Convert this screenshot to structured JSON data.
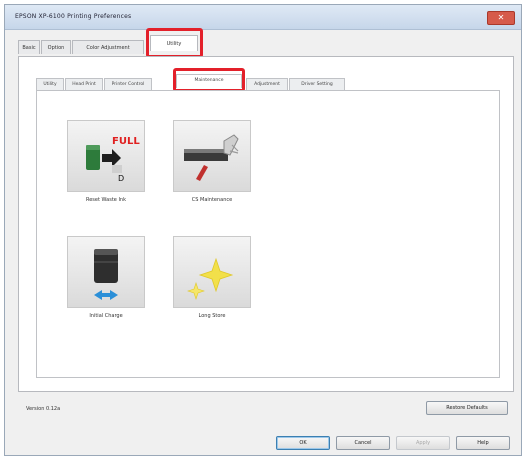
{
  "window": {
    "title": "EPSON XP-6100 Printing Preferences",
    "close_label": "✕"
  },
  "tabs": [
    {
      "label": "Basic"
    },
    {
      "label": "Option"
    },
    {
      "label": "Color Adjustment"
    },
    {
      "label": "Utility",
      "active": true
    }
  ],
  "subtabs": [
    {
      "label": "Utility"
    },
    {
      "label": "Head Print"
    },
    {
      "label": "Printer Control"
    },
    {
      "label": "Maintenance",
      "active": true
    },
    {
      "label": "Adjustment"
    },
    {
      "label": "Driver Setting"
    }
  ],
  "tiles": [
    {
      "label": "Reset Waste Ink",
      "icon": "waste-ink-icon"
    },
    {
      "label": "CS Maintenance",
      "icon": "maintenance-icon"
    },
    {
      "label": "Initial Charge",
      "icon": "ink-charge-icon"
    },
    {
      "label": "Long Store",
      "icon": "sparkle-icon"
    }
  ],
  "full_text": "FULL",
  "version": "Version 0.12a",
  "buttons": {
    "restore_defaults": "Restore Defaults",
    "ok": "OK",
    "cancel": "Cancel",
    "apply": "Apply",
    "help": "Help"
  },
  "colors": {
    "highlight": "#e3202a",
    "accent": "#3c7fb1"
  }
}
